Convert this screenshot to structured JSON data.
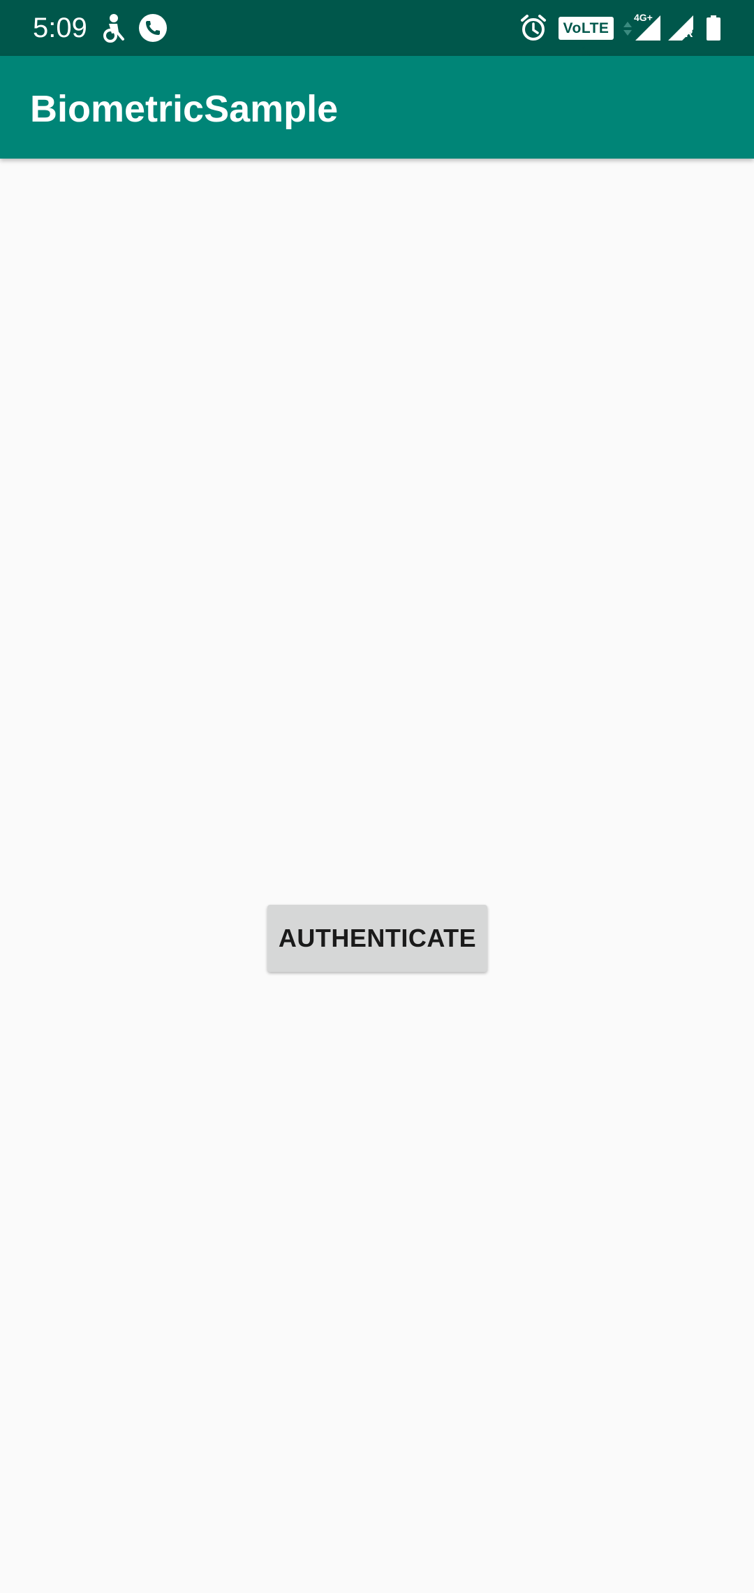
{
  "status_bar": {
    "time": "5:09",
    "left_icons": [
      "app-notification-icon",
      "phone-call-icon"
    ],
    "right_icons": [
      "alarm-icon",
      "volte-icon",
      "data-activity-icon",
      "signal-icon",
      "roaming-signal-icon",
      "battery-icon"
    ],
    "volte_label": "VoLTE 1",
    "network_type": "4G+",
    "roaming_label": "R",
    "background_color": "#00574b"
  },
  "app_bar": {
    "title": "BiometricSample",
    "background_color": "#008577"
  },
  "main": {
    "authenticate_button_label": "AUTHENTICATE",
    "button_color": "#d6d7d7"
  }
}
